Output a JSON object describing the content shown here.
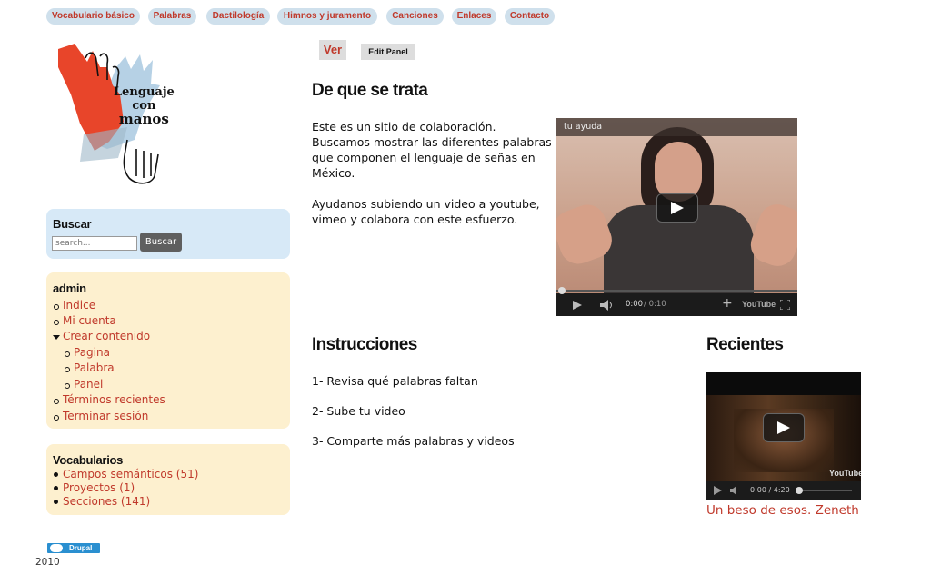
{
  "nav": {
    "items": [
      "Vocabulario básico",
      "Palabras",
      "Dactilología",
      "Himnos y juramento",
      "Canciones",
      "Enlaces",
      "Contacto"
    ]
  },
  "logo": {
    "line1": "Lenguaje",
    "line2": "con",
    "line3": "manos"
  },
  "search": {
    "title": "Buscar",
    "placeholder": "search...",
    "button": "Buscar"
  },
  "admin": {
    "title": "admin",
    "indice": "Indice",
    "mi_cuenta": "Mi cuenta",
    "crear": "Crear contenido",
    "pagina": "Pagina",
    "palabra": "Palabra",
    "panel": "Panel",
    "terminos": "Términos recientes",
    "terminar": "Terminar sesión"
  },
  "vocab": {
    "title": "Vocabularios",
    "items": [
      "Campos semánticos (51)",
      "Proyectos (1)",
      "Secciones (141)"
    ]
  },
  "footer": {
    "drupal": "Drupal",
    "year": "2010"
  },
  "tabs": {
    "ver": "Ver",
    "edit": "Edit Panel"
  },
  "main": {
    "title": "De que se trata",
    "p1": "Este es un sitio de colaboración. Buscamos mostrar las diferentes palabras que componen el lenguaje de señas en México.",
    "p2": "Ayudanos subiendo un video a youtube, vimeo y colabora con este esfuerzo."
  },
  "video1": {
    "title": "tu ayuda",
    "time_current": "0:00",
    "time_total": "/ 0:10"
  },
  "instrucciones": {
    "title": "Instrucciones",
    "steps": [
      "1- Revisa qué palabras faltan",
      "2- Sube tu video",
      "3- Comparte más palabras y videos"
    ]
  },
  "recientes": {
    "title": "Recientes",
    "time": "0:00 / 4:20",
    "caption": "Un beso de esos. Zeneth"
  },
  "colors": {
    "accent": "#c0392b",
    "nav_pill": "#cfe0ec",
    "search_box": "#d7e9f7",
    "admin_box": "#fdf0cf"
  }
}
